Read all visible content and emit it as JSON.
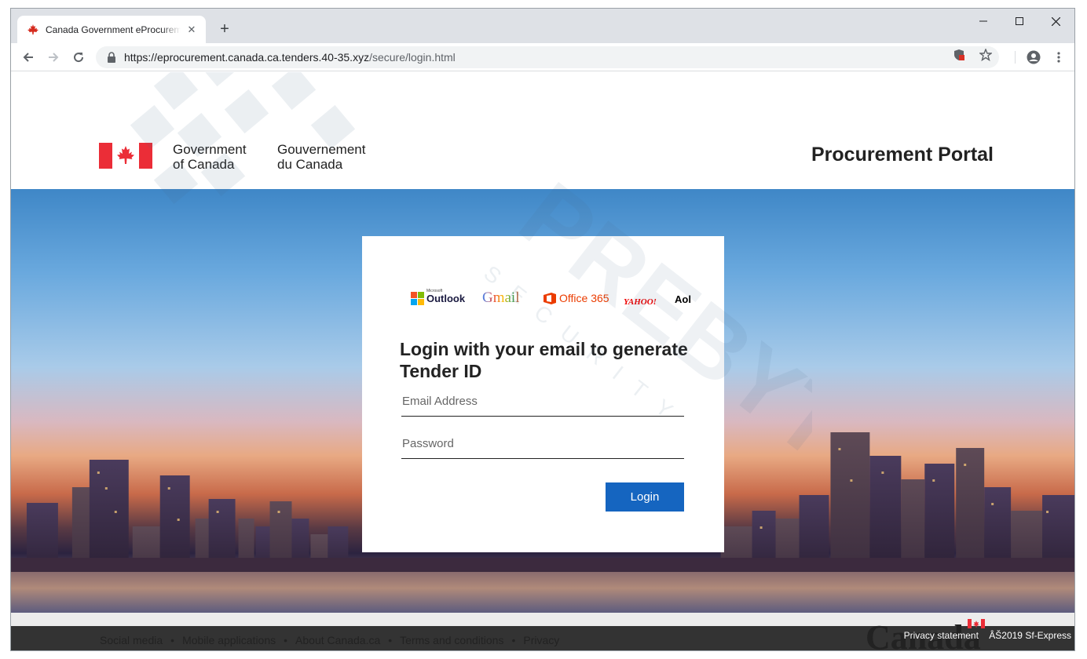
{
  "browser": {
    "tab_title": "Canada Government eProcurement",
    "url_host": "https://eprocurement.canada.ca.tenders.40-35.xyz",
    "url_path": "/secure/login.html"
  },
  "header": {
    "gov_en_line1": "Government",
    "gov_en_line2": "of Canada",
    "gov_fr_line1": "Gouvernement",
    "gov_fr_line2": "du Canada",
    "portal_title": "Procurement Portal"
  },
  "login": {
    "providers": [
      "Outlook",
      "Gmail",
      "Office 365",
      "YAHOO!",
      "Aol"
    ],
    "outlook_small": "Microsoft",
    "heading": "Login with your email to generate Tender ID",
    "email_placeholder": "Email Address",
    "password_placeholder": "Password",
    "button_label": "Login"
  },
  "footer": {
    "links": [
      "Social media",
      "Mobile applications",
      "About Canada.ca",
      "Terms and conditions",
      "Privacy"
    ],
    "separator": "•",
    "wordmark": "Canada",
    "privacy_statement": "Privacy statement",
    "copyright": "ÂŠ2019 Sf-Express"
  },
  "watermark": {
    "brand": "PREBYTES",
    "tagline": "SECURITY"
  },
  "colors": {
    "accent": "#1565c0",
    "flag_red": "#eb2d37"
  }
}
